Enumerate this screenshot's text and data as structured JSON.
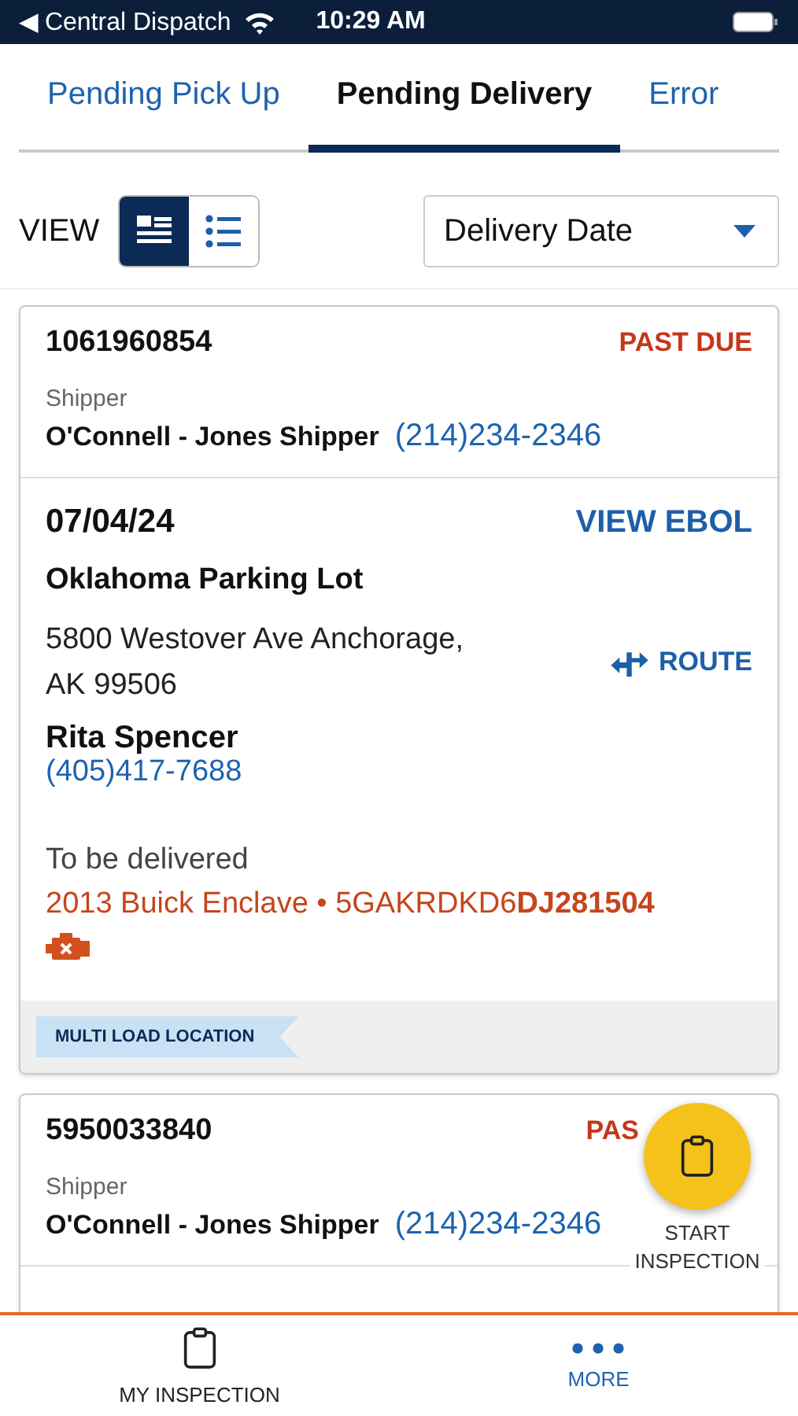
{
  "status_bar": {
    "back_label": "◀ Central Dispatch",
    "time": "10:29 AM"
  },
  "tabs": [
    {
      "label": "Pending Pick Up",
      "selected": false
    },
    {
      "label": "Pending Delivery",
      "selected": true
    },
    {
      "label": "Error",
      "selected": false
    }
  ],
  "view": {
    "label": "VIEW",
    "options": [
      {
        "kind": "cards",
        "selected": true
      },
      {
        "kind": "list",
        "selected": false
      }
    ]
  },
  "sort": {
    "value": "Delivery Date"
  },
  "loads": [
    {
      "id": "1061960854",
      "status": "PAST DUE",
      "shipper_label": "Shipper",
      "shipper_name": "O'Connell - Jones Shipper",
      "shipper_phone": "(214)234-2346",
      "date": "07/04/24",
      "action": "VIEW EBOL",
      "location": "Oklahoma Parking Lot",
      "address": "5800 Westover Ave Anchorage, AK 99506",
      "route_label": "ROUTE",
      "contact_name": "Rita Spencer",
      "contact_phone": "(405)417-7688",
      "delivery_label": "To be delivered",
      "vehicle": "2013 Buick Enclave • 5GAKRDKD6**DJ281504**",
      "engine_warning": true,
      "tag": "MULTI LOAD LOCATION"
    },
    {
      "id": "5950033840",
      "status": "PAS",
      "shipper_label": "Shipper",
      "shipper_name": "O'Connell - Jones Shipper",
      "shipper_phone": "(214)234-2346"
    }
  ],
  "fab": {
    "label": "START INSPECTION"
  },
  "bottom_nav": [
    {
      "label": "MY INSPECTION",
      "kind": "inspection",
      "selected": false
    },
    {
      "label": "MORE",
      "kind": "more",
      "selected": true
    }
  ]
}
